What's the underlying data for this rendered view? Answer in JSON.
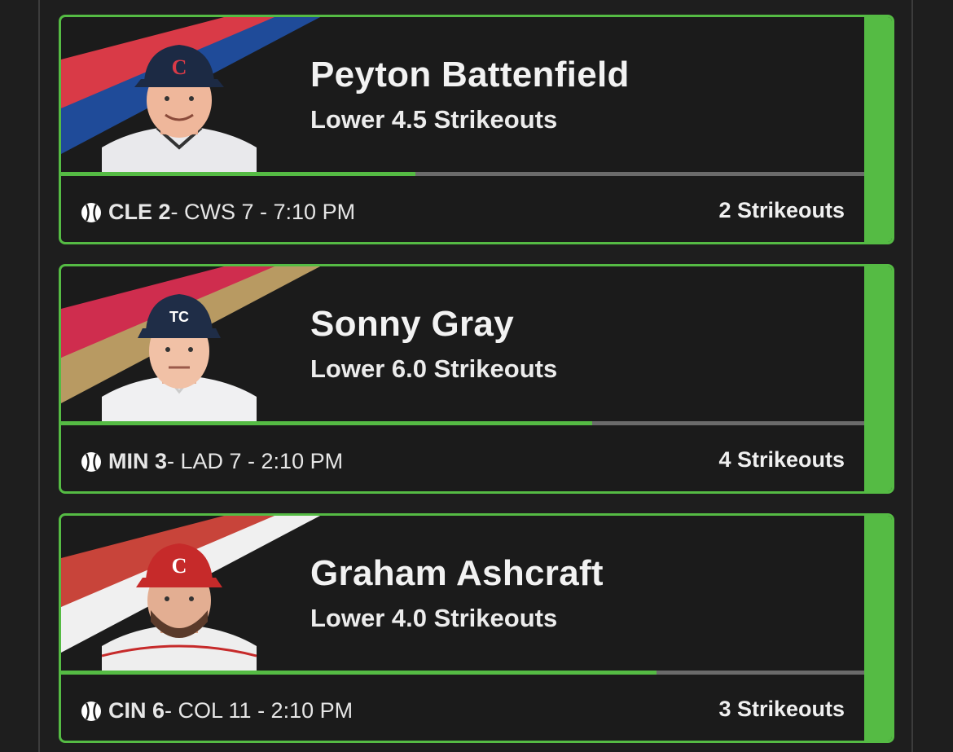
{
  "cards": [
    {
      "player": "Peyton Battenfield",
      "prop": "Lower 4.5 Strikeouts",
      "team": "CLE 2",
      "rest": " - CWS 7 - 7:10 PM",
      "result": "2 Strikeouts",
      "progress": 0.44,
      "team_colors": [
        "#d93a47",
        "#1f4b99"
      ],
      "cap_color": "#1c2a44",
      "cap_logo": "C",
      "cap_logo_color": "#d93a47",
      "icon": "baseball-icon"
    },
    {
      "player": "Sonny Gray",
      "prop": "Lower 6.0 Strikeouts",
      "team": "MIN 3",
      "rest": " - LAD 7 - 2:10 PM",
      "result": "4 Strikeouts",
      "progress": 0.66,
      "team_colors": [
        "#cf2d4e",
        "#b89a62"
      ],
      "cap_color": "#1f2d47",
      "cap_logo": "TC",
      "cap_logo_color": "#ffffff",
      "icon": "baseball-icon"
    },
    {
      "player": "Graham Ashcraft",
      "prop": "Lower 4.0 Strikeouts",
      "team": "CIN 6",
      "rest": " - COL 11 - 2:10 PM",
      "result": "3 Strikeouts",
      "progress": 0.74,
      "team_colors": [
        "#c8443a",
        "#f0f0f0"
      ],
      "cap_color": "#c62a2a",
      "cap_logo": "C",
      "cap_logo_color": "#ffffff",
      "icon": "baseball-icon"
    }
  ]
}
